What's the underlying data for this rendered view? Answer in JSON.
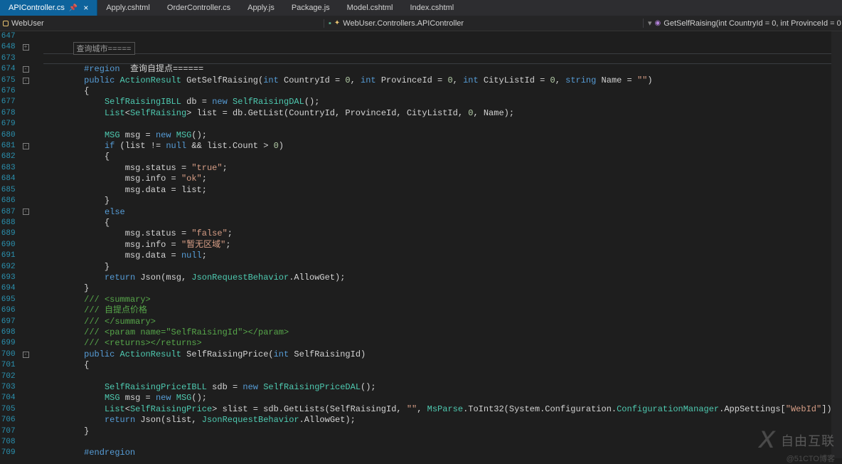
{
  "tabs": [
    {
      "label": "APIController.cs",
      "active": true,
      "pinned": true
    },
    {
      "label": "Apply.cshtml",
      "active": false
    },
    {
      "label": "OrderController.cs",
      "active": false
    },
    {
      "label": "Apply.js",
      "active": false
    },
    {
      "label": "Package.js",
      "active": false
    },
    {
      "label": "Model.cshtml",
      "active": false
    },
    {
      "label": "Index.cshtml",
      "active": false
    }
  ],
  "breadcrumb": {
    "left_label": "WebUser",
    "middle_label": "WebUser.Controllers.APIController",
    "right_label": "GetSelfRaising(int CountryId = 0, int ProvinceId = 0"
  },
  "hover_box": "查询城市=====",
  "line_numbers": [
    647,
    648,
    673,
    674,
    675,
    676,
    677,
    678,
    679,
    680,
    681,
    682,
    683,
    684,
    685,
    686,
    687,
    688,
    689,
    690,
    691,
    692,
    693,
    694,
    695,
    696,
    697,
    698,
    699,
    700,
    701,
    702,
    703,
    704,
    705,
    706,
    707,
    708,
    709
  ],
  "fold_markers": [
    {
      "line_index": 1,
      "symbol": "+"
    },
    {
      "line_index": 3,
      "symbol": "-"
    },
    {
      "line_index": 4,
      "symbol": "-"
    },
    {
      "line_index": 10,
      "symbol": "-"
    },
    {
      "line_index": 16,
      "symbol": "-"
    },
    {
      "line_index": 29,
      "symbol": "-"
    }
  ],
  "code_lines": [
    {
      "tokens": []
    },
    {
      "tokens": []
    },
    {
      "tokens": []
    },
    {
      "tokens": [
        {
          "t": "        ",
          "c": ""
        },
        {
          "t": "#region",
          "c": "k-blue"
        },
        {
          "t": "  查询自提点======",
          "c": ""
        }
      ]
    },
    {
      "tokens": [
        {
          "t": "        ",
          "c": ""
        },
        {
          "t": "public",
          "c": "k-blue"
        },
        {
          "t": " ",
          "c": ""
        },
        {
          "t": "ActionResult",
          "c": "k-type"
        },
        {
          "t": " GetSelfRaising(",
          "c": ""
        },
        {
          "t": "int",
          "c": "k-blue"
        },
        {
          "t": " CountryId = ",
          "c": ""
        },
        {
          "t": "0",
          "c": "k-num"
        },
        {
          "t": ", ",
          "c": ""
        },
        {
          "t": "int",
          "c": "k-blue"
        },
        {
          "t": " ProvinceId = ",
          "c": ""
        },
        {
          "t": "0",
          "c": "k-num"
        },
        {
          "t": ", ",
          "c": ""
        },
        {
          "t": "int",
          "c": "k-blue"
        },
        {
          "t": " CityListId = ",
          "c": ""
        },
        {
          "t": "0",
          "c": "k-num"
        },
        {
          "t": ", ",
          "c": ""
        },
        {
          "t": "string",
          "c": "k-blue"
        },
        {
          "t": " Name = ",
          "c": ""
        },
        {
          "t": "\"\"",
          "c": "k-str"
        },
        {
          "t": ")",
          "c": ""
        }
      ]
    },
    {
      "tokens": [
        {
          "t": "        {",
          "c": ""
        }
      ]
    },
    {
      "tokens": [
        {
          "t": "            ",
          "c": ""
        },
        {
          "t": "SelfRaisingIBLL",
          "c": "k-type"
        },
        {
          "t": " db = ",
          "c": ""
        },
        {
          "t": "new",
          "c": "k-blue"
        },
        {
          "t": " ",
          "c": ""
        },
        {
          "t": "SelfRaisingDAL",
          "c": "k-type"
        },
        {
          "t": "();",
          "c": ""
        }
      ]
    },
    {
      "tokens": [
        {
          "t": "            ",
          "c": ""
        },
        {
          "t": "List",
          "c": "k-type"
        },
        {
          "t": "<",
          "c": ""
        },
        {
          "t": "SelfRaising",
          "c": "k-type"
        },
        {
          "t": "> list = db.GetList(CountryId, ProvinceId, CityListId, ",
          "c": ""
        },
        {
          "t": "0",
          "c": "k-num"
        },
        {
          "t": ", Name);",
          "c": ""
        }
      ]
    },
    {
      "tokens": []
    },
    {
      "tokens": [
        {
          "t": "            ",
          "c": ""
        },
        {
          "t": "MSG",
          "c": "k-type"
        },
        {
          "t": " msg = ",
          "c": ""
        },
        {
          "t": "new",
          "c": "k-blue"
        },
        {
          "t": " ",
          "c": ""
        },
        {
          "t": "MSG",
          "c": "k-type"
        },
        {
          "t": "();",
          "c": ""
        }
      ]
    },
    {
      "tokens": [
        {
          "t": "            ",
          "c": ""
        },
        {
          "t": "if",
          "c": "k-blue"
        },
        {
          "t": " (list != ",
          "c": ""
        },
        {
          "t": "null",
          "c": "k-blue"
        },
        {
          "t": " && list.Count > ",
          "c": ""
        },
        {
          "t": "0",
          "c": "k-num"
        },
        {
          "t": ")",
          "c": ""
        }
      ]
    },
    {
      "tokens": [
        {
          "t": "            {",
          "c": ""
        }
      ]
    },
    {
      "tokens": [
        {
          "t": "                msg.status = ",
          "c": ""
        },
        {
          "t": "\"true\"",
          "c": "k-str"
        },
        {
          "t": ";",
          "c": ""
        }
      ]
    },
    {
      "tokens": [
        {
          "t": "                msg.info = ",
          "c": ""
        },
        {
          "t": "\"ok\"",
          "c": "k-str"
        },
        {
          "t": ";",
          "c": ""
        }
      ]
    },
    {
      "tokens": [
        {
          "t": "                msg.data = list;",
          "c": ""
        }
      ]
    },
    {
      "tokens": [
        {
          "t": "            }",
          "c": ""
        }
      ]
    },
    {
      "tokens": [
        {
          "t": "            ",
          "c": ""
        },
        {
          "t": "else",
          "c": "k-blue"
        }
      ]
    },
    {
      "tokens": [
        {
          "t": "            {",
          "c": ""
        }
      ]
    },
    {
      "tokens": [
        {
          "t": "                msg.status = ",
          "c": ""
        },
        {
          "t": "\"false\"",
          "c": "k-str"
        },
        {
          "t": ";",
          "c": ""
        }
      ]
    },
    {
      "tokens": [
        {
          "t": "                msg.info = ",
          "c": ""
        },
        {
          "t": "\"暂无区域\"",
          "c": "k-str"
        },
        {
          "t": ";",
          "c": ""
        }
      ]
    },
    {
      "tokens": [
        {
          "t": "                msg.data = ",
          "c": ""
        },
        {
          "t": "null",
          "c": "k-blue"
        },
        {
          "t": ";",
          "c": ""
        }
      ]
    },
    {
      "tokens": [
        {
          "t": "            }",
          "c": ""
        }
      ]
    },
    {
      "tokens": [
        {
          "t": "            ",
          "c": ""
        },
        {
          "t": "return",
          "c": "k-blue"
        },
        {
          "t": " Json(msg, ",
          "c": ""
        },
        {
          "t": "JsonRequestBehavior",
          "c": "k-type"
        },
        {
          "t": ".AllowGet);",
          "c": ""
        }
      ]
    },
    {
      "tokens": [
        {
          "t": "        }",
          "c": ""
        }
      ]
    },
    {
      "tokens": [
        {
          "t": "        ",
          "c": ""
        },
        {
          "t": "/// ",
          "c": "k-doc"
        },
        {
          "t": "<summary>",
          "c": "k-doc"
        }
      ]
    },
    {
      "tokens": [
        {
          "t": "        ",
          "c": ""
        },
        {
          "t": "/// ",
          "c": "k-doc"
        },
        {
          "t": "自提点价格",
          "c": "k-comment"
        }
      ]
    },
    {
      "tokens": [
        {
          "t": "        ",
          "c": ""
        },
        {
          "t": "/// ",
          "c": "k-doc"
        },
        {
          "t": "</summary>",
          "c": "k-doc"
        }
      ]
    },
    {
      "tokens": [
        {
          "t": "        ",
          "c": ""
        },
        {
          "t": "/// ",
          "c": "k-doc"
        },
        {
          "t": "<param name=",
          "c": "k-doc"
        },
        {
          "t": "\"SelfRaisingId\"",
          "c": "k-doc"
        },
        {
          "t": "></param>",
          "c": "k-doc"
        }
      ]
    },
    {
      "tokens": [
        {
          "t": "        ",
          "c": ""
        },
        {
          "t": "/// ",
          "c": "k-doc"
        },
        {
          "t": "<returns></returns>",
          "c": "k-doc"
        }
      ]
    },
    {
      "tokens": [
        {
          "t": "        ",
          "c": ""
        },
        {
          "t": "public",
          "c": "k-blue"
        },
        {
          "t": " ",
          "c": ""
        },
        {
          "t": "ActionResult",
          "c": "k-type"
        },
        {
          "t": " SelfRaisingPrice(",
          "c": ""
        },
        {
          "t": "int",
          "c": "k-blue"
        },
        {
          "t": " SelfRaisingId)",
          "c": ""
        }
      ]
    },
    {
      "tokens": [
        {
          "t": "        {",
          "c": ""
        }
      ]
    },
    {
      "tokens": []
    },
    {
      "tokens": [
        {
          "t": "            ",
          "c": ""
        },
        {
          "t": "SelfRaisingPriceIBLL",
          "c": "k-type"
        },
        {
          "t": " sdb = ",
          "c": ""
        },
        {
          "t": "new",
          "c": "k-blue"
        },
        {
          "t": " ",
          "c": ""
        },
        {
          "t": "SelfRaisingPriceDAL",
          "c": "k-type"
        },
        {
          "t": "();",
          "c": ""
        }
      ]
    },
    {
      "tokens": [
        {
          "t": "            ",
          "c": ""
        },
        {
          "t": "MSG",
          "c": "k-type"
        },
        {
          "t": " msg = ",
          "c": ""
        },
        {
          "t": "new",
          "c": "k-blue"
        },
        {
          "t": " ",
          "c": ""
        },
        {
          "t": "MSG",
          "c": "k-type"
        },
        {
          "t": "();",
          "c": ""
        }
      ]
    },
    {
      "tokens": [
        {
          "t": "            ",
          "c": ""
        },
        {
          "t": "List",
          "c": "k-type"
        },
        {
          "t": "<",
          "c": ""
        },
        {
          "t": "SelfRaisingPrice",
          "c": "k-type"
        },
        {
          "t": "> slist = sdb.GetLists(SelfRaisingId, ",
          "c": ""
        },
        {
          "t": "\"\"",
          "c": "k-str"
        },
        {
          "t": ", ",
          "c": ""
        },
        {
          "t": "MsParse",
          "c": "k-type"
        },
        {
          "t": ".ToInt32(System.Configuration.",
          "c": ""
        },
        {
          "t": "ConfigurationManager",
          "c": "k-type"
        },
        {
          "t": ".AppSettings[",
          "c": ""
        },
        {
          "t": "\"WebId\"",
          "c": "k-str"
        },
        {
          "t": "]));",
          "c": ""
        }
      ]
    },
    {
      "tokens": [
        {
          "t": "            ",
          "c": ""
        },
        {
          "t": "return",
          "c": "k-blue"
        },
        {
          "t": " Json(slist, ",
          "c": ""
        },
        {
          "t": "JsonRequestBehavior",
          "c": "k-type"
        },
        {
          "t": ".AllowGet);",
          "c": ""
        }
      ]
    },
    {
      "tokens": [
        {
          "t": "        }",
          "c": ""
        }
      ]
    },
    {
      "tokens": []
    },
    {
      "tokens": [
        {
          "t": "        ",
          "c": ""
        },
        {
          "t": "#endregion",
          "c": "k-blue"
        }
      ]
    }
  ],
  "watermark": {
    "logo": "X",
    "text": "自由互联",
    "sub": "@51CTO博客"
  }
}
